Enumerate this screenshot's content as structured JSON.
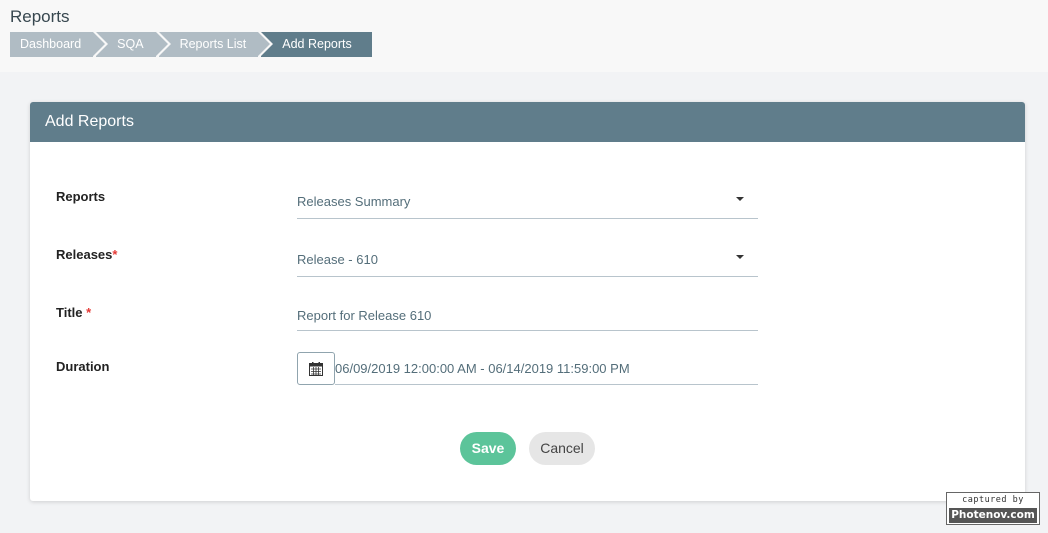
{
  "header": {
    "title": "Reports",
    "breadcrumb": [
      "Dashboard",
      "SQA",
      "Reports List",
      "Add Reports"
    ]
  },
  "card": {
    "title": "Add Reports",
    "fields": {
      "reports": {
        "label": "Reports",
        "value": "Releases Summary"
      },
      "releases": {
        "label": "Releases",
        "required_mark": "*",
        "value": "Release - 610"
      },
      "title": {
        "label": "Title",
        "required_mark": "*",
        "value": "Report for Release 610"
      },
      "duration": {
        "label": "Duration",
        "value": "06/09/2019 12:00:00 AM - 06/14/2019 11:59:00 PM",
        "icon": "calendar-icon"
      }
    },
    "buttons": {
      "save": "Save",
      "cancel": "Cancel"
    }
  },
  "watermark": {
    "top": "captured by",
    "bottom": "Photenov.com"
  },
  "colors": {
    "header_bar": "#607d8b",
    "crumb_inactive": "#b0bcc4",
    "save_button": "#5cc49a",
    "required": "#e53935"
  }
}
